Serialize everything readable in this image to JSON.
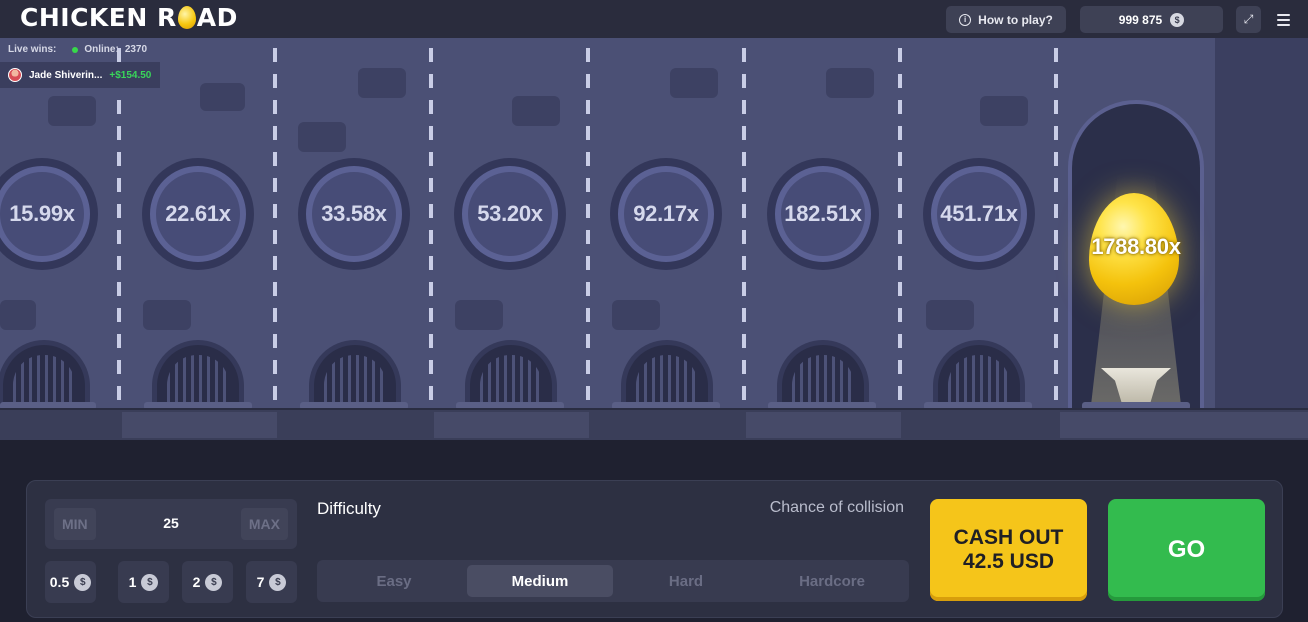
{
  "header": {
    "logo_left": "CHICKEN R",
    "logo_right": "AD",
    "how_to_play": "How to play?",
    "balance": "999 875",
    "currency_symbol": "$"
  },
  "live": {
    "label": "Live wins:",
    "online_label": "Online:",
    "online_count": "2370",
    "win_name": "Jade Shiverin...",
    "win_amount": "+$154.50"
  },
  "multipliers": [
    "15.99x",
    "22.61x",
    "33.58x",
    "53.20x",
    "92.17x",
    "182.51x",
    "451.71x"
  ],
  "final_multiplier": "1788.80x",
  "controls": {
    "min_label": "MIN",
    "max_label": "MAX",
    "bet_value": "25",
    "quick_bets": [
      "0.5",
      "1",
      "2",
      "7"
    ],
    "difficulty_label": "Difficulty",
    "chance_label": "Chance of collision",
    "difficulties": [
      "Easy",
      "Medium",
      "Hard",
      "Hardcore"
    ],
    "active_difficulty": "Medium",
    "cashout_line1": "CASH OUT",
    "cashout_line2": "42.5 USD",
    "go_label": "GO"
  },
  "colors": {
    "cashout": "#f5c51a",
    "go": "#33bb4e",
    "win_amount": "#39d65a",
    "accent_egg": "#f4c20c"
  }
}
